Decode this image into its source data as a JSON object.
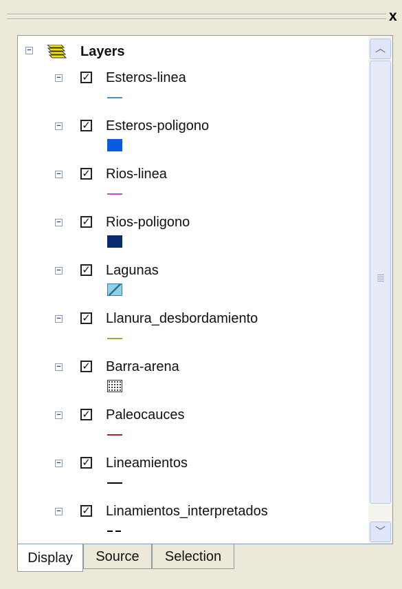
{
  "window": {
    "close_label": "x"
  },
  "toc": {
    "root_label": "Layers",
    "layers": [
      {
        "name": "Esteros-linea",
        "symbol": "line",
        "color": "#4a90c2"
      },
      {
        "name": "Esteros-poligono",
        "symbol": "fill",
        "color": "#0a5be0"
      },
      {
        "name": "Rios-linea",
        "symbol": "line",
        "color": "#c44cc4"
      },
      {
        "name": "Rios-poligono",
        "symbol": "fill",
        "color": "#0a2a6e"
      },
      {
        "name": "Lagunas",
        "symbol": "hatch",
        "color": "#8fd1e8"
      },
      {
        "name": "Llanura_desbordamiento",
        "symbol": "line",
        "color": "#9aab3a"
      },
      {
        "name": "Barra-arena",
        "symbol": "dots",
        "color": "#ffffff"
      },
      {
        "name": "Paleocauces",
        "symbol": "line",
        "color": "#a52a2a"
      },
      {
        "name": "Lineamientos",
        "symbol": "line",
        "color": "#000000"
      },
      {
        "name": "Linamientos_interpretados",
        "symbol": "dashed",
        "color": "#000000"
      }
    ]
  },
  "tabs": [
    {
      "label": "Display",
      "active": true
    },
    {
      "label": "Source",
      "active": false
    },
    {
      "label": "Selection",
      "active": false
    }
  ]
}
